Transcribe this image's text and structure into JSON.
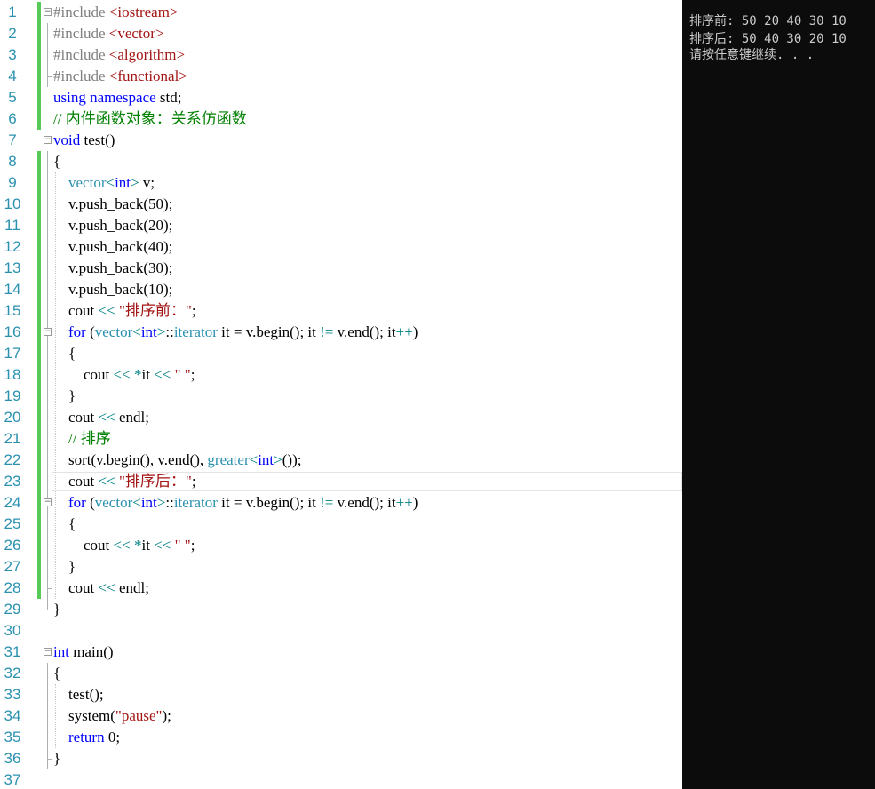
{
  "editor": {
    "lines": [
      {
        "n": "1",
        "tokens": [
          {
            "t": "#include ",
            "c": "pp"
          },
          {
            "t": "<iostream>",
            "c": "inc"
          }
        ]
      },
      {
        "n": "2",
        "tokens": [
          {
            "t": "#include ",
            "c": "pp"
          },
          {
            "t": "<vector>",
            "c": "inc"
          }
        ]
      },
      {
        "n": "3",
        "tokens": [
          {
            "t": "#include ",
            "c": "pp"
          },
          {
            "t": "<algorithm>",
            "c": "inc"
          }
        ]
      },
      {
        "n": "4",
        "tokens": [
          {
            "t": "#include ",
            "c": "pp"
          },
          {
            "t": "<functional>",
            "c": "inc"
          }
        ]
      },
      {
        "n": "5",
        "tokens": [
          {
            "t": "using",
            "c": "kw"
          },
          {
            "t": " "
          },
          {
            "t": "namespace",
            "c": "kw"
          },
          {
            "t": " std;"
          }
        ]
      },
      {
        "n": "6",
        "tokens": [
          {
            "t": "// 内件函数对象：关系仿函数",
            "c": "cm"
          }
        ]
      },
      {
        "n": "7",
        "tokens": [
          {
            "t": "void",
            "c": "kw"
          },
          {
            "t": " test()"
          }
        ]
      },
      {
        "n": "8",
        "tokens": [
          {
            "t": "{"
          }
        ]
      },
      {
        "n": "9",
        "tokens": [
          {
            "t": "    "
          },
          {
            "t": "vector",
            "c": "ty"
          },
          {
            "t": "<",
            "c": "op"
          },
          {
            "t": "int",
            "c": "kw"
          },
          {
            "t": ">",
            "c": "op"
          },
          {
            "t": " v;"
          }
        ]
      },
      {
        "n": "10",
        "tokens": [
          {
            "t": "    v.push_back(50);"
          }
        ]
      },
      {
        "n": "11",
        "tokens": [
          {
            "t": "    v.push_back(20);"
          }
        ]
      },
      {
        "n": "12",
        "tokens": [
          {
            "t": "    v.push_back(40);"
          }
        ]
      },
      {
        "n": "13",
        "tokens": [
          {
            "t": "    v.push_back(30);"
          }
        ]
      },
      {
        "n": "14",
        "tokens": [
          {
            "t": "    v.push_back(10);"
          }
        ]
      },
      {
        "n": "15",
        "tokens": [
          {
            "t": "    cout "
          },
          {
            "t": "<<",
            "c": "op"
          },
          {
            "t": " "
          },
          {
            "t": "\"排序前：\"",
            "c": "str"
          },
          {
            "t": ";"
          }
        ]
      },
      {
        "n": "16",
        "tokens": [
          {
            "t": "    "
          },
          {
            "t": "for",
            "c": "kw"
          },
          {
            "t": " ("
          },
          {
            "t": "vector",
            "c": "ty"
          },
          {
            "t": "<",
            "c": "op"
          },
          {
            "t": "int",
            "c": "kw"
          },
          {
            "t": ">",
            "c": "op"
          },
          {
            "t": "::"
          },
          {
            "t": "iterator",
            "c": "ty"
          },
          {
            "t": " it = v.begin(); it "
          },
          {
            "t": "!=",
            "c": "op"
          },
          {
            "t": " v.end(); it"
          },
          {
            "t": "++",
            "c": "op"
          },
          {
            "t": ")"
          }
        ]
      },
      {
        "n": "17",
        "tokens": [
          {
            "t": "    {"
          }
        ]
      },
      {
        "n": "18",
        "tokens": [
          {
            "t": "        cout "
          },
          {
            "t": "<<",
            "c": "op"
          },
          {
            "t": " "
          },
          {
            "t": "*",
            "c": "op"
          },
          {
            "t": "it "
          },
          {
            "t": "<<",
            "c": "op"
          },
          {
            "t": " "
          },
          {
            "t": "\" \"",
            "c": "str"
          },
          {
            "t": ";"
          }
        ]
      },
      {
        "n": "19",
        "tokens": [
          {
            "t": "    }"
          }
        ]
      },
      {
        "n": "20",
        "tokens": [
          {
            "t": "    cout "
          },
          {
            "t": "<<",
            "c": "op"
          },
          {
            "t": " endl;"
          }
        ]
      },
      {
        "n": "21",
        "tokens": [
          {
            "t": "    "
          },
          {
            "t": "// 排序",
            "c": "cm"
          }
        ]
      },
      {
        "n": "22",
        "tokens": [
          {
            "t": "    sort(v.begin(), v.end(), "
          },
          {
            "t": "greater",
            "c": "ty"
          },
          {
            "t": "<",
            "c": "op"
          },
          {
            "t": "int",
            "c": "kw"
          },
          {
            "t": ">",
            "c": "op"
          },
          {
            "t": "());"
          }
        ]
      },
      {
        "n": "23",
        "tokens": [
          {
            "t": "    cout "
          },
          {
            "t": "<<",
            "c": "op"
          },
          {
            "t": " "
          },
          {
            "t": "\"排序后：\"",
            "c": "str"
          },
          {
            "t": ";"
          }
        ]
      },
      {
        "n": "24",
        "tokens": [
          {
            "t": "    "
          },
          {
            "t": "for",
            "c": "kw"
          },
          {
            "t": " ("
          },
          {
            "t": "vector",
            "c": "ty"
          },
          {
            "t": "<",
            "c": "op"
          },
          {
            "t": "int",
            "c": "kw"
          },
          {
            "t": ">",
            "c": "op"
          },
          {
            "t": "::"
          },
          {
            "t": "iterator",
            "c": "ty"
          },
          {
            "t": " it = v.begin(); it "
          },
          {
            "t": "!=",
            "c": "op"
          },
          {
            "t": " v.end(); it"
          },
          {
            "t": "++",
            "c": "op"
          },
          {
            "t": ")"
          }
        ]
      },
      {
        "n": "25",
        "tokens": [
          {
            "t": "    {"
          }
        ]
      },
      {
        "n": "26",
        "tokens": [
          {
            "t": "        cout "
          },
          {
            "t": "<<",
            "c": "op"
          },
          {
            "t": " "
          },
          {
            "t": "*",
            "c": "op"
          },
          {
            "t": "it "
          },
          {
            "t": "<<",
            "c": "op"
          },
          {
            "t": " "
          },
          {
            "t": "\" \"",
            "c": "str"
          },
          {
            "t": ";"
          }
        ]
      },
      {
        "n": "27",
        "tokens": [
          {
            "t": "    }"
          }
        ]
      },
      {
        "n": "28",
        "tokens": [
          {
            "t": "    cout "
          },
          {
            "t": "<<",
            "c": "op"
          },
          {
            "t": " endl;"
          }
        ]
      },
      {
        "n": "29",
        "tokens": [
          {
            "t": "}"
          }
        ]
      },
      {
        "n": "30",
        "tokens": []
      },
      {
        "n": "31",
        "tokens": [
          {
            "t": "int",
            "c": "kw"
          },
          {
            "t": " main()"
          }
        ]
      },
      {
        "n": "32",
        "tokens": [
          {
            "t": "{"
          }
        ]
      },
      {
        "n": "33",
        "tokens": [
          {
            "t": "    test();"
          }
        ]
      },
      {
        "n": "34",
        "tokens": [
          {
            "t": "    system("
          },
          {
            "t": "\"pause\"",
            "c": "str"
          },
          {
            "t": ");"
          }
        ]
      },
      {
        "n": "35",
        "tokens": [
          {
            "t": "    "
          },
          {
            "t": "return",
            "c": "kw"
          },
          {
            "t": " 0;"
          }
        ]
      },
      {
        "n": "36",
        "tokens": [
          {
            "t": "}"
          }
        ]
      },
      {
        "n": "37",
        "tokens": []
      }
    ]
  },
  "console": {
    "lines": [
      "排序前: 50 20 40 30 10",
      "排序后: 50 40 30 20 10",
      "请按任意键继续. . ."
    ]
  },
  "colors": {
    "keyword": "#0000ff",
    "type": "#2b91af",
    "string": "#a31515",
    "comment": "#008000",
    "preprocessor": "#808080",
    "operator": "#008080",
    "line_number": "#2b91af",
    "change_marker": "#57c957",
    "console_bg": "#0c0c0c",
    "console_fg": "#cccccc"
  },
  "icons": {
    "fold_collapse": "minus-box-icon"
  }
}
